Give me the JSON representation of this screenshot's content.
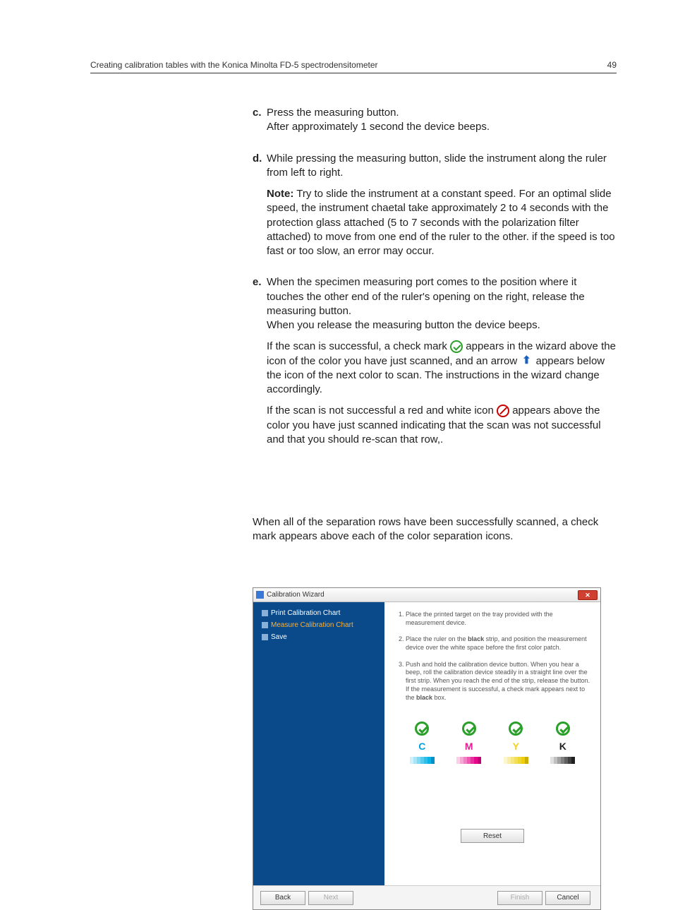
{
  "header": {
    "title": "Creating calibration tables with the Konica Minolta FD-5 spectrodensitometer",
    "page_number": "49"
  },
  "steps": {
    "c": {
      "marker": "c.",
      "line1": "Press the measuring button.",
      "line2": "After approximately 1 second the device beeps."
    },
    "d": {
      "marker": "d.",
      "line1": "While pressing the measuring button, slide the instrument along the ruler from left to right.",
      "note_label": "Note:",
      "note_body": " Try to slide the instrument at a constant speed. For an optimal slide speed, the instrument chaetal take approximately 2 to 4 seconds with the protection glass attached (5 to 7 seconds with the polarization filter attached) to move from one end of the ruler to the other. if the speed is too fast or too slow, an error may occur."
    },
    "e": {
      "marker": "e.",
      "line1": "When the specimen measuring port comes to the position where it touches the other end of the ruler's opening on the right, release the measuring button.",
      "line2": "When you release the measuring button the device beeps.",
      "success_a": "If the scan is successful, a check mark ",
      "success_b": " appears in the wizard above the icon of the color you have just scanned, and an arrow ",
      "success_c": " appears below the icon of the next color to scan. The instructions in the wizard change accordingly.",
      "fail_a": "If the scan is not successful a red and white icon ",
      "fail_b": " appears above the color you have just scanned indicating that the scan was not successful and that you should re-scan that row,."
    }
  },
  "summary": "When all of the separation rows have been successfully scanned, a check mark appears above each of the color separation icons.",
  "wizard": {
    "title": "Calibration Wizard",
    "close_glyph": "✕",
    "sidebar": {
      "items": [
        {
          "label": "Print Calibration Chart",
          "active": false
        },
        {
          "label": "Measure Calibration Chart",
          "active": true
        },
        {
          "label": "Save",
          "active": false
        }
      ]
    },
    "instructions": {
      "i1_a": "Place the printed target on the tray provided with the measurement device.",
      "i2_a": "Place the ruler on the ",
      "i2_bold": "black",
      "i2_b": " strip, and position the measurement device over the white space before the first color patch.",
      "i3_a": "Push and hold the calibration device button. When you hear a beep, roll the calibration device steadily in a straight line over the first strip. When you reach the end of the strip, release the button. If the measurement is successful, a check mark appears next to the ",
      "i3_bold": "black",
      "i3_b": " box."
    },
    "colors": [
      {
        "letter": "C",
        "letter_color": "#00a0e0"
      },
      {
        "letter": "M",
        "letter_color": "#e02090"
      },
      {
        "letter": "Y",
        "letter_color": "#f0d020"
      },
      {
        "letter": "K",
        "letter_color": "#222222"
      }
    ],
    "buttons": {
      "reset": "Reset",
      "back": "Back",
      "next": "Next",
      "finish": "Finish",
      "cancel": "Cancel"
    }
  },
  "strips": {
    "C": [
      "#d0f0fa",
      "#a8e4f6",
      "#80d8f2",
      "#58ccee",
      "#30bfe9",
      "#08b3e5",
      "#0090c8"
    ],
    "M": [
      "#fad0e6",
      "#f6a8d4",
      "#f280c2",
      "#ee58b0",
      "#e9309e",
      "#e5088c",
      "#c00074"
    ],
    "Y": [
      "#fcf6d0",
      "#f9eea8",
      "#f6e680",
      "#f3de58",
      "#f0d630",
      "#edce08",
      "#ccae00"
    ],
    "K": [
      "#e0e0e0",
      "#c0c0c0",
      "#a0a0a0",
      "#808080",
      "#606060",
      "#404040",
      "#202020"
    ]
  }
}
